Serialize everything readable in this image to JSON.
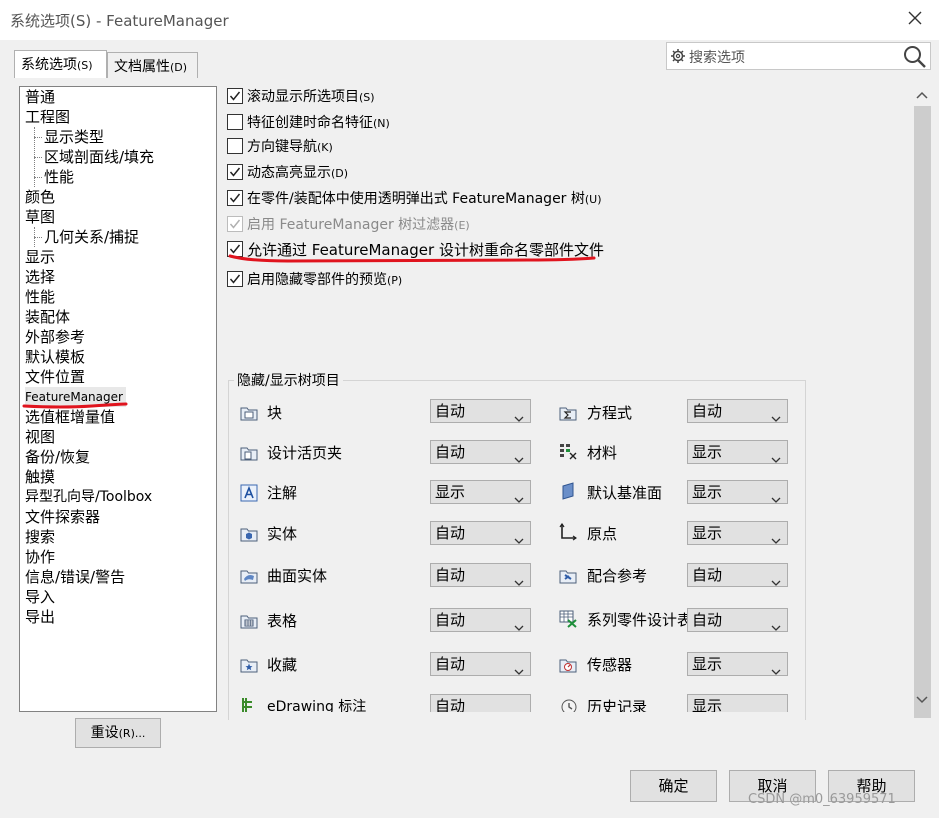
{
  "window": {
    "title": "系统选项(S) - FeatureManager"
  },
  "tabs": [
    {
      "label": "系统选项",
      "key": "(S)",
      "active": true
    },
    {
      "label": "文档属性",
      "key": "(D)",
      "active": false
    }
  ],
  "search": {
    "placeholder": "搜索选项"
  },
  "tree": {
    "items": [
      {
        "label": "普通",
        "level": 0
      },
      {
        "label": "工程图",
        "level": 0
      },
      {
        "label": "显示类型",
        "level": 1
      },
      {
        "label": "区域剖面线/填充",
        "level": 1
      },
      {
        "label": "性能",
        "level": 1
      },
      {
        "label": "颜色",
        "level": 0
      },
      {
        "label": "草图",
        "level": 0
      },
      {
        "label": "几何关系/捕捉",
        "level": 1
      },
      {
        "label": "显示",
        "level": 0
      },
      {
        "label": "选择",
        "level": 0
      },
      {
        "label": "性能",
        "level": 0
      },
      {
        "label": "装配体",
        "level": 0
      },
      {
        "label": "外部参考",
        "level": 0
      },
      {
        "label": "默认模板",
        "level": 0
      },
      {
        "label": "文件位置",
        "level": 0
      },
      {
        "label": "FeatureManager",
        "level": 0,
        "selected": true
      },
      {
        "label": "选值框增量值",
        "level": 0
      },
      {
        "label": "视图",
        "level": 0
      },
      {
        "label": "备份/恢复",
        "level": 0
      },
      {
        "label": "触摸",
        "level": 0
      },
      {
        "label": "异型孔向导/Toolbox",
        "level": 0
      },
      {
        "label": "文件探索器",
        "level": 0
      },
      {
        "label": "搜索",
        "level": 0
      },
      {
        "label": "协作",
        "level": 0
      },
      {
        "label": "信息/错误/警告",
        "level": 0
      },
      {
        "label": "导入",
        "level": 0
      },
      {
        "label": "导出",
        "level": 0
      }
    ]
  },
  "reset_button": {
    "label": "重设",
    "key": "(R)..."
  },
  "options": [
    {
      "label": "滚动显示所选项目",
      "key": "(S)",
      "checked": true,
      "disabled": false
    },
    {
      "label": "特征创建时命名特征",
      "key": "(N)",
      "checked": false,
      "disabled": false
    },
    {
      "label": "方向键导航",
      "key": "(K)",
      "checked": false,
      "disabled": false
    },
    {
      "label": "动态高亮显示",
      "key": "(D)",
      "checked": true,
      "disabled": false
    },
    {
      "label": "在零件/装配体中使用透明弹出式 FeatureManager 树",
      "key": "(U)",
      "checked": true,
      "disabled": false
    },
    {
      "label": "启用 FeatureManager 树过滤器",
      "key": "(E)",
      "checked": true,
      "disabled": true
    },
    {
      "label": "允许通过 FeatureManager 设计树重命名零部件文件",
      "key": "",
      "checked": true,
      "disabled": false
    },
    {
      "label": "启用隐藏零部件的预览",
      "key": "(P)",
      "checked": true,
      "disabled": false
    }
  ],
  "group": {
    "title": "隐藏/显示树项目",
    "left": [
      {
        "label": "块",
        "value": "自动",
        "icon": "block-icon"
      },
      {
        "label": "设计活页夹",
        "value": "自动",
        "icon": "design-binder-icon"
      },
      {
        "label": "注解",
        "value": "显示",
        "icon": "annotation-icon"
      },
      {
        "label": "实体",
        "value": "自动",
        "icon": "solid-body-icon"
      },
      {
        "label": "曲面实体",
        "value": "自动",
        "icon": "surface-body-icon"
      },
      {
        "label": "表格",
        "value": "自动",
        "icon": "table-icon"
      },
      {
        "label": "收藏",
        "value": "自动",
        "icon": "favorites-icon"
      },
      {
        "label": "eDrawing 标注",
        "value": "自动",
        "icon": "edrawing-markup-icon"
      }
    ],
    "right": [
      {
        "label": "方程式",
        "value": "自动",
        "icon": "equation-icon"
      },
      {
        "label": "材料",
        "value": "显示",
        "icon": "material-icon"
      },
      {
        "label": "默认基准面",
        "value": "显示",
        "icon": "default-plane-icon"
      },
      {
        "label": "原点",
        "value": "显示",
        "icon": "origin-icon"
      },
      {
        "label": "配合参考",
        "value": "自动",
        "icon": "mate-reference-icon"
      },
      {
        "label": "系列零件设计表",
        "value": "自动",
        "icon": "design-table-icon"
      },
      {
        "label": "传感器",
        "value": "显示",
        "icon": "sensor-icon"
      },
      {
        "label": "历史记录",
        "value": "显示",
        "icon": "history-icon"
      }
    ]
  },
  "buttons": {
    "ok": "确定",
    "cancel": "取消",
    "help": "帮助"
  },
  "watermark": "CSDN @m0_63959571",
  "colors": {
    "annotation_red": "#e0141e",
    "checkbox_border": "#333333"
  }
}
